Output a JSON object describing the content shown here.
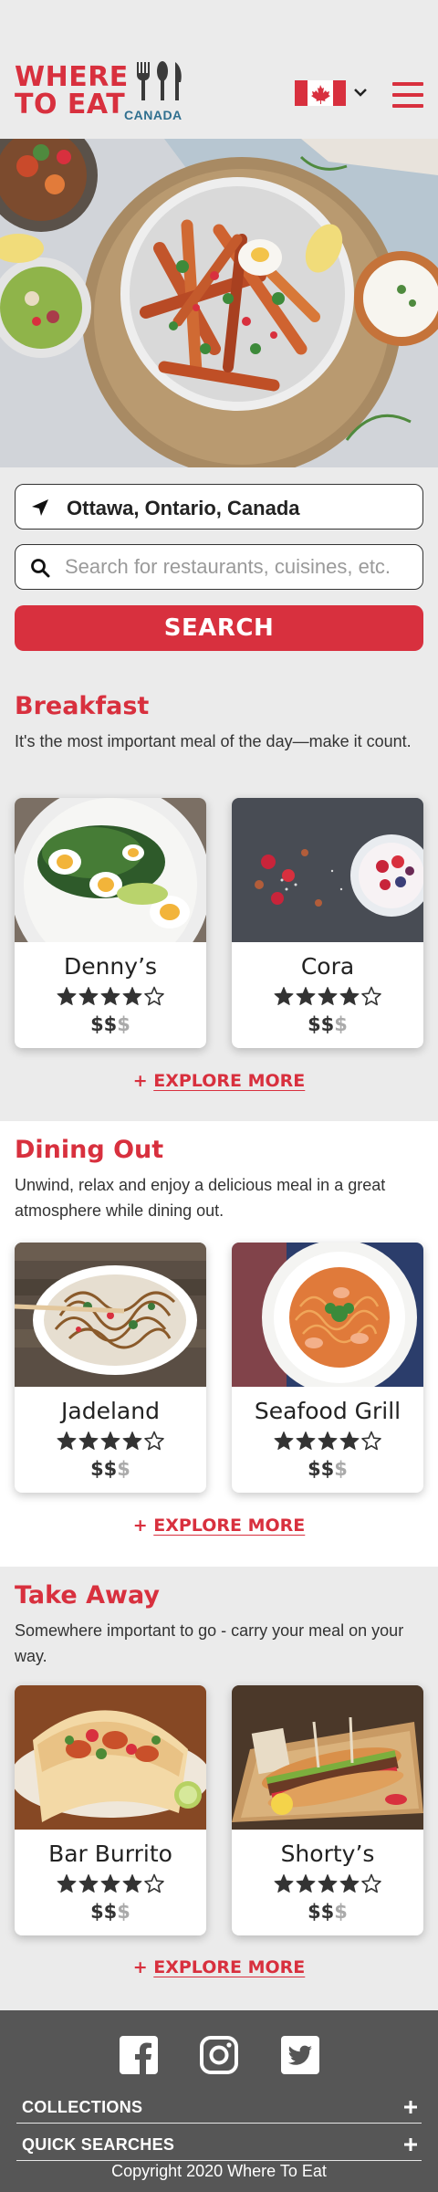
{
  "brand": {
    "line1": "WHERE",
    "line2": "TO EAT",
    "country": "CANADA",
    "accent_color": "#d8303e"
  },
  "header": {
    "flag_icon": "canada-flag-icon",
    "menu_icon": "hamburger-icon"
  },
  "search": {
    "location_value": "Ottawa, Ontario, Canada",
    "query_placeholder": "Search for restaurants, cuisines, etc.",
    "button_label": "SEARCH"
  },
  "sections": [
    {
      "title": "Breakfast",
      "description": "It's the most important meal of the day—make it count.",
      "explore_plus": "+",
      "explore_label": "EXPLORE MORE",
      "cards": [
        {
          "name": "Denny’s",
          "rating": 4,
          "price_on": "$$",
          "price_off": "$"
        },
        {
          "name": "Cora",
          "rating": 4,
          "price_on": "$$",
          "price_off": "$"
        }
      ]
    },
    {
      "title": "Dining Out",
      "description": "Unwind, relax and enjoy a delicious meal in a great atmosphere while dining out.",
      "explore_plus": "+",
      "explore_label": "EXPLORE MORE",
      "cards": [
        {
          "name": "Jadeland",
          "rating": 4,
          "price_on": "$$",
          "price_off": "$"
        },
        {
          "name": "Seafood Grill",
          "rating": 4,
          "price_on": "$$",
          "price_off": "$"
        }
      ]
    },
    {
      "title": "Take Away",
      "description": "Somewhere important to go - carry your meal on your way.",
      "explore_plus": "+",
      "explore_label": "EXPLORE MORE",
      "cards": [
        {
          "name": "Bar Burrito",
          "rating": 4,
          "price_on": "$$",
          "price_off": "$"
        },
        {
          "name": "Shorty’s",
          "rating": 4,
          "price_on": "$$",
          "price_off": "$"
        }
      ]
    }
  ],
  "footer": {
    "social": [
      "facebook-icon",
      "instagram-icon",
      "twitter-icon"
    ],
    "collections_label": "COLLECTIONS",
    "quick_searches_label": "QUICK SEARCHES",
    "copyright": "Copyright 2020  Where To Eat"
  }
}
